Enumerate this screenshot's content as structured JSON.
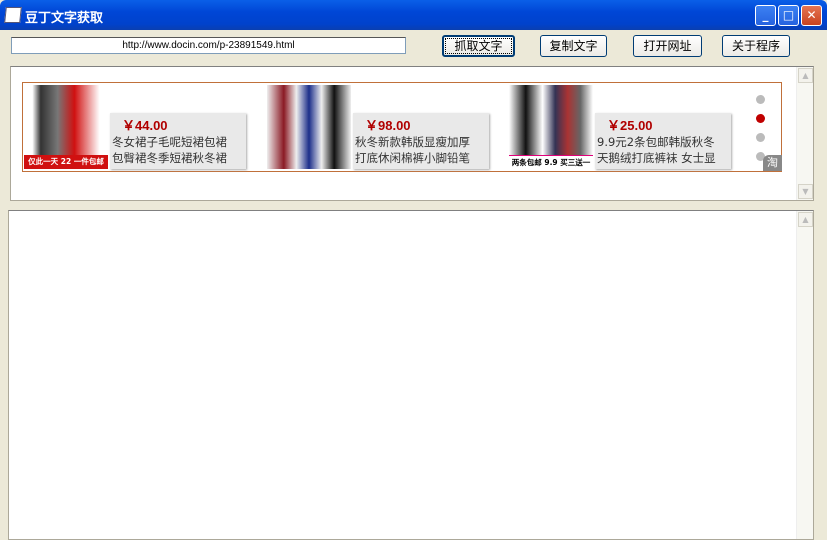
{
  "window": {
    "title": "豆丁文字获取"
  },
  "toolbar": {
    "url": "http://www.docin.com/p-23891549.html",
    "grab": "抓取文字",
    "copy": "复制文字",
    "open": "打开网址",
    "about": "关于程序"
  },
  "ad": {
    "badge": "淘",
    "active_slide": 2,
    "items": [
      {
        "price": "￥44.00",
        "desc1": "冬女裙子毛呢短裙包裙",
        "desc2": "包臀裙冬季短裙秋冬裙",
        "img_caption": "仅此一天 22 一件包邮"
      },
      {
        "price": "￥98.00",
        "desc1": "秋冬新款韩版显瘦加厚",
        "desc2": "打底休闲棉裤小脚铅笔"
      },
      {
        "price": "￥25.00",
        "desc1": "9.9元2条包邮韩版秋冬",
        "desc2": "天鹅绒打底裤袜 女士显",
        "img_caption": "两条包邮 9.9 买三送一"
      }
    ]
  }
}
